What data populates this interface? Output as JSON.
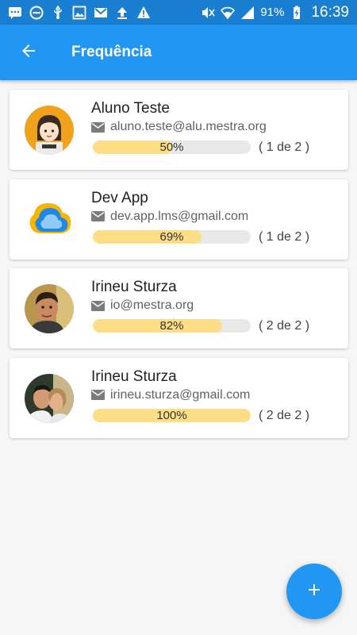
{
  "status_bar": {
    "battery": "91%",
    "time": "16:39",
    "icons_left": [
      "message-icon",
      "do-not-disturb-icon",
      "usb-icon",
      "image-icon",
      "gmail-icon",
      "upload-icon",
      "warning-icon"
    ],
    "icons_right": [
      "mute-icon",
      "wifi-icon",
      "signal-icon",
      "battery-charging-icon"
    ]
  },
  "app_bar": {
    "title": "Frequência",
    "back_icon": "arrow-back-icon",
    "color": "#2196f3"
  },
  "students": [
    {
      "name": "Aluno Teste",
      "email": "aluno.teste@alu.mestra.org",
      "progress": 0.5,
      "progress_label": "50%",
      "count": "( 1 de 2 )",
      "avatar": "cartoon-girl-avatar"
    },
    {
      "name": "Dev App",
      "email": "dev.app.lms@gmail.com",
      "progress": 0.69,
      "progress_label": "69%",
      "count": "( 1 de 2 )",
      "avatar": "cloud-logo-avatar"
    },
    {
      "name": "Irineu Sturza",
      "email": "io@mestra.org",
      "progress": 0.82,
      "progress_label": "82%",
      "count": "( 2 de 2 )",
      "avatar": "man-photo-avatar"
    },
    {
      "name": "Irineu Sturza",
      "email": "irineu.sturza@gmail.com",
      "progress": 1.0,
      "progress_label": "100%",
      "count": "( 2 de 2 )",
      "avatar": "couple-photo-avatar"
    }
  ],
  "fab": {
    "icon": "add-icon"
  },
  "colors": {
    "progress_fill": "#fddd86",
    "progress_track": "#e8e8e8",
    "background": "#f6f6f6"
  }
}
